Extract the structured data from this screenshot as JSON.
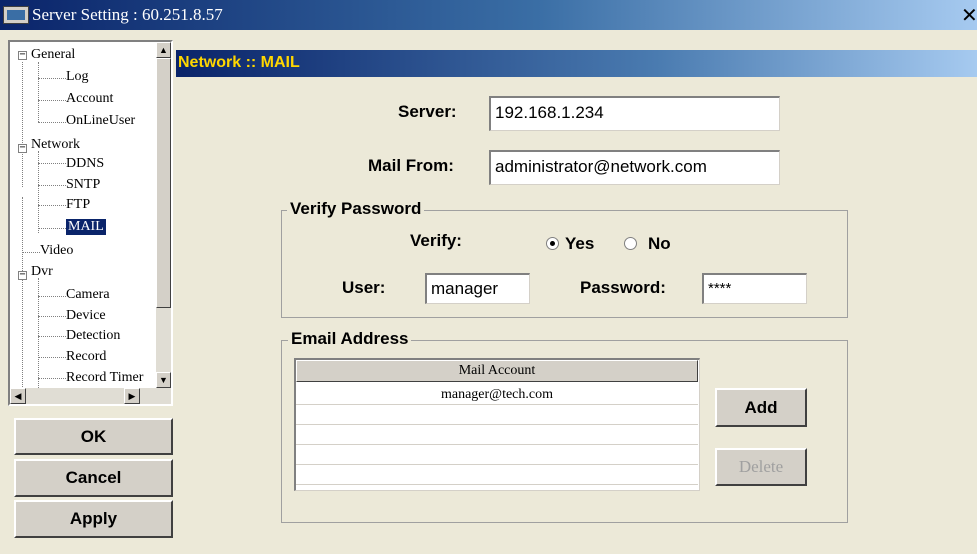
{
  "window": {
    "title": "Server Setting : 60.251.8.57",
    "close_glyph": "✕"
  },
  "tree": {
    "general": "General",
    "log": "Log",
    "account": "Account",
    "online_user": "OnLineUser",
    "network": "Network",
    "ddns": "DDNS",
    "sntp": "SNTP",
    "ftp": "FTP",
    "mail": "MAIL",
    "video": "Video",
    "dvr": "Dvr",
    "camera": "Camera",
    "device": "Device",
    "detection": "Detection",
    "record": "Record",
    "record_timer": "Record Timer",
    "expander_collapse": "−"
  },
  "buttons": {
    "ok": "OK",
    "cancel": "Cancel",
    "apply": "Apply",
    "add": "Add",
    "delete": "Delete"
  },
  "header": {
    "title": "Network :: MAIL"
  },
  "form": {
    "server_label": "Server:",
    "server_value": "192.168.1.234",
    "mail_from_label": "Mail From:",
    "mail_from_value": "administrator@network.com"
  },
  "verify": {
    "group_title": "Verify Password",
    "verify_label": "Verify:",
    "yes": "Yes",
    "no": "No",
    "selected": "Yes",
    "user_label": "User:",
    "user_value": "manager",
    "password_label": "Password:",
    "password_value": "****"
  },
  "email": {
    "group_title": "Email Address",
    "column_header": "Mail Account",
    "rows": [
      "manager@tech.com",
      "",
      "",
      "",
      "",
      ""
    ]
  },
  "colors": {
    "title_gradient_start": "#0a246a",
    "header_text": "#ffd700",
    "selection": "#0a246a",
    "face": "#ece9d8"
  }
}
